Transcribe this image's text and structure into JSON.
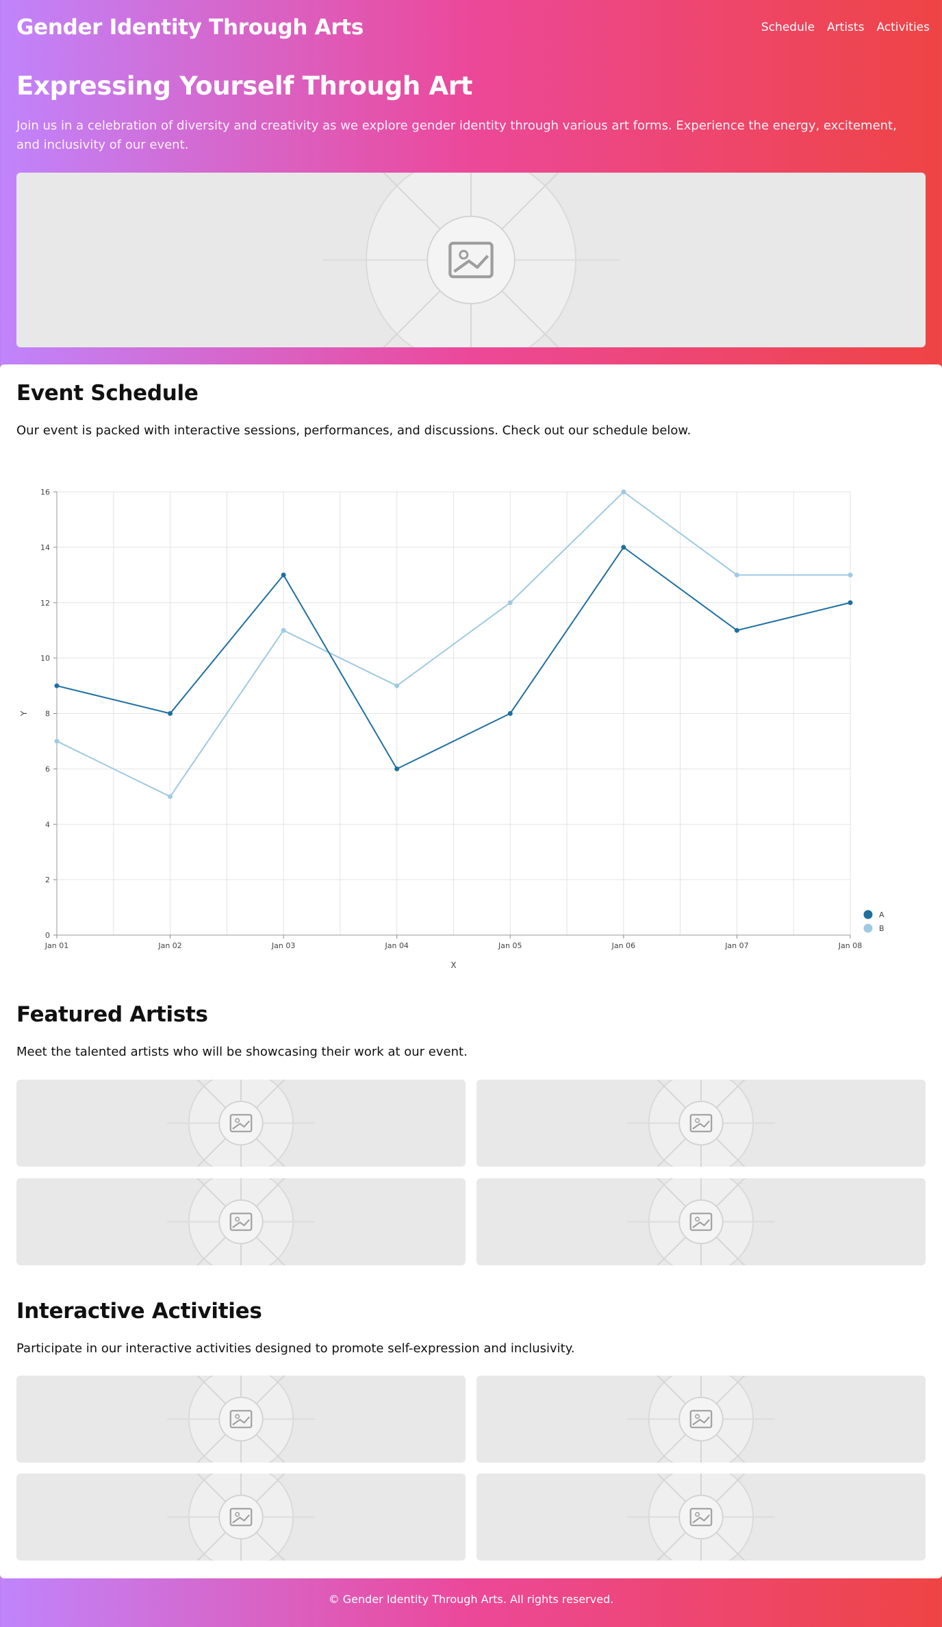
{
  "header": {
    "brand": "Gender Identity Through Arts",
    "nav": [
      "Schedule",
      "Artists",
      "Activities"
    ]
  },
  "hero": {
    "title": "Expressing Yourself Through Art",
    "text": "Join us in a celebration of diversity and creativity as we explore gender identity through various art forms. Experience the energy, excitement, and inclusivity of our event."
  },
  "schedule": {
    "title": "Event Schedule",
    "text": "Our event is packed with interactive sessions, performances, and discussions. Check out our schedule below."
  },
  "artists": {
    "title": "Featured Artists",
    "text": "Meet the talented artists who will be showcasing their work at our event."
  },
  "activities": {
    "title": "Interactive Activities",
    "text": "Participate in our interactive activities designed to promote self-expression and inclusivity."
  },
  "footer": {
    "text": "© Gender Identity Through Arts. All rights reserved."
  },
  "icons": {
    "placeholder": "image-icon"
  },
  "colors": {
    "series_a": "#1f6f9f",
    "series_b": "#9ecae1"
  },
  "chart_data": {
    "type": "line",
    "categories": [
      "Jan 01",
      "Jan 02",
      "Jan 03",
      "Jan 04",
      "Jan 05",
      "Jan 06",
      "Jan 07",
      "Jan 08"
    ],
    "series": [
      {
        "name": "A",
        "values": [
          9,
          8,
          13,
          6,
          8,
          14,
          11,
          12
        ]
      },
      {
        "name": "B",
        "values": [
          7,
          5,
          11,
          9,
          12,
          16,
          13,
          13
        ]
      }
    ],
    "xlabel": "X",
    "ylabel": "Y",
    "ylim": [
      0,
      16
    ],
    "yticks": [
      0,
      2,
      4,
      6,
      8,
      10,
      12,
      14,
      16
    ],
    "grid": true,
    "legend": "bottom-right"
  }
}
